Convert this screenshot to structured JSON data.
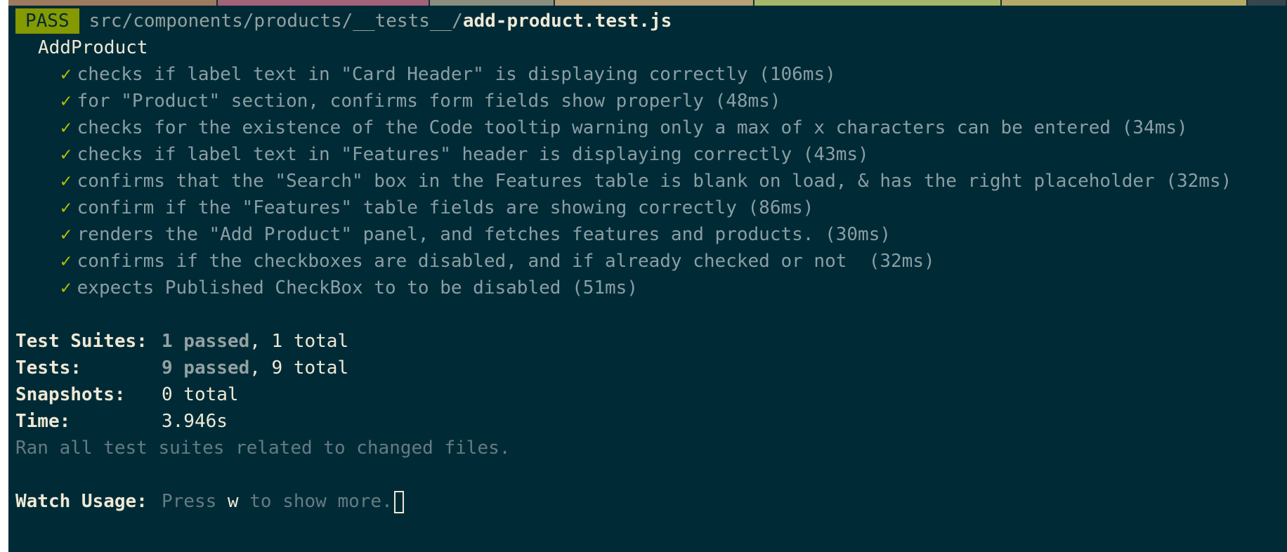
{
  "colors": {
    "background": "#002b36",
    "pass_badge": "#859900",
    "check": "#b5c200",
    "tab_segments": [
      "#9e7a5e",
      "#a1627a",
      "#8a8e7e",
      "#b8a078",
      "#a5b86a",
      "#b5a968",
      "#35474c"
    ]
  },
  "header": {
    "badge": "PASS",
    "path_dim": "src/components/products/__tests__/",
    "path_file": "add-product.test.js"
  },
  "suite": {
    "name": "AddProduct",
    "check_icon": "✓",
    "tests": [
      {
        "title": "checks if label text in \"Card Header\" is displaying correctly",
        "duration": "(106ms)"
      },
      {
        "title": "for \"Product\" section, confirms form fields show properly",
        "duration": "(48ms)"
      },
      {
        "title": "checks for the existence of the Code tooltip warning only a max of x characters can be entered",
        "duration": "(34ms)"
      },
      {
        "title": "checks if label text in \"Features\" header is displaying correctly",
        "duration": "(43ms)"
      },
      {
        "title": "confirms that the \"Search\" box in the Features table is blank on load, & has the right placeholder",
        "duration": "(32ms)"
      },
      {
        "title": "confirm if the \"Features\" table fields are showing correctly",
        "duration": "(86ms)"
      },
      {
        "title": "renders the \"Add Product\" panel, and fetches features and products.",
        "duration": "(30ms)"
      },
      {
        "title": "confirms if the checkboxes are disabled, and if already checked or not ",
        "duration": "(32ms)"
      },
      {
        "title": "expects Published CheckBox to to be disabled",
        "duration": "(51ms)"
      }
    ]
  },
  "summary": {
    "suites_label": "Test Suites:",
    "suites_passed": "1 passed",
    "suites_total": ", 1 total",
    "tests_label": "Tests:",
    "tests_passed": "9 passed",
    "tests_total": ", 9 total",
    "snapshots_label": "Snapshots:",
    "snapshots_value": "0 total",
    "time_label": "Time:",
    "time_value": "3.946s",
    "ran_note": "Ran all test suites related to changed files."
  },
  "watch": {
    "label": "Watch Usage:",
    "press": "Press ",
    "key": "w",
    "rest": " to show more."
  }
}
